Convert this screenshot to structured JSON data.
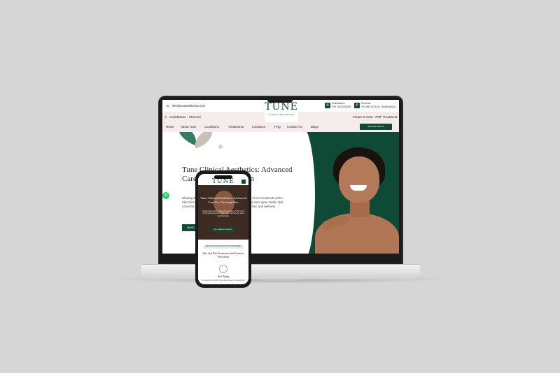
{
  "site": {
    "email": "info@tuneaesthetics.com",
    "location": "Coimbatore , Chennai",
    "logo": "TUNE",
    "logo_sub": "CLINICAL AESTHETICS",
    "phones": [
      {
        "city": "Coimbatore",
        "number": "+91 7670226226"
      },
      {
        "city": "Chennai",
        "number": "+91 9871232231, 9444030033"
      }
    ],
    "future": "Future Is Now : PRF Treatment",
    "nav": [
      "Home",
      "About Tune",
      "Conditions",
      "Treatments",
      "Locations",
      "FAQ",
      "Contact Us",
      "Blogs"
    ],
    "appointment": "APPOINTMENT",
    "hero": {
      "title": "Tune Clinical Aesthetics: Advanced Care For Glowing Skin",
      "desc": "Glowing skin doesn't happen by chance, it's the result of our treatments at the Skin Clinic and the confidence that brings an outer and inner glow. Tackle skin concerns with expert care and solutions for your skin, hair, and wellness.",
      "button": "MAKE AN APPOINTMENT"
    }
  },
  "phone": {
    "logo": "TUNE",
    "hero_title": "Tune Clinical Aesthetics: Advanced Care For Glowing Skin",
    "hero_desc": "Glowing skin doesn't happen by chance, it's the result of our treatments at the Skin Clinic that bring an outer and inner glow.",
    "hero_button": "BOOK AN APPOINTMENT",
    "badge": "FREE SKIN CONSULTATION BY APPOINTMENT",
    "section": "Skin And Hair Treatments And Cosmetic Procedures",
    "card_title": "Anti-Aging",
    "card_desc": "Turn back the clock with our advanced care for ageing skin."
  },
  "colors": {
    "brand": "#0f4a36",
    "bg": "#d6d6d6",
    "accent_bar": "#f6eceb"
  }
}
